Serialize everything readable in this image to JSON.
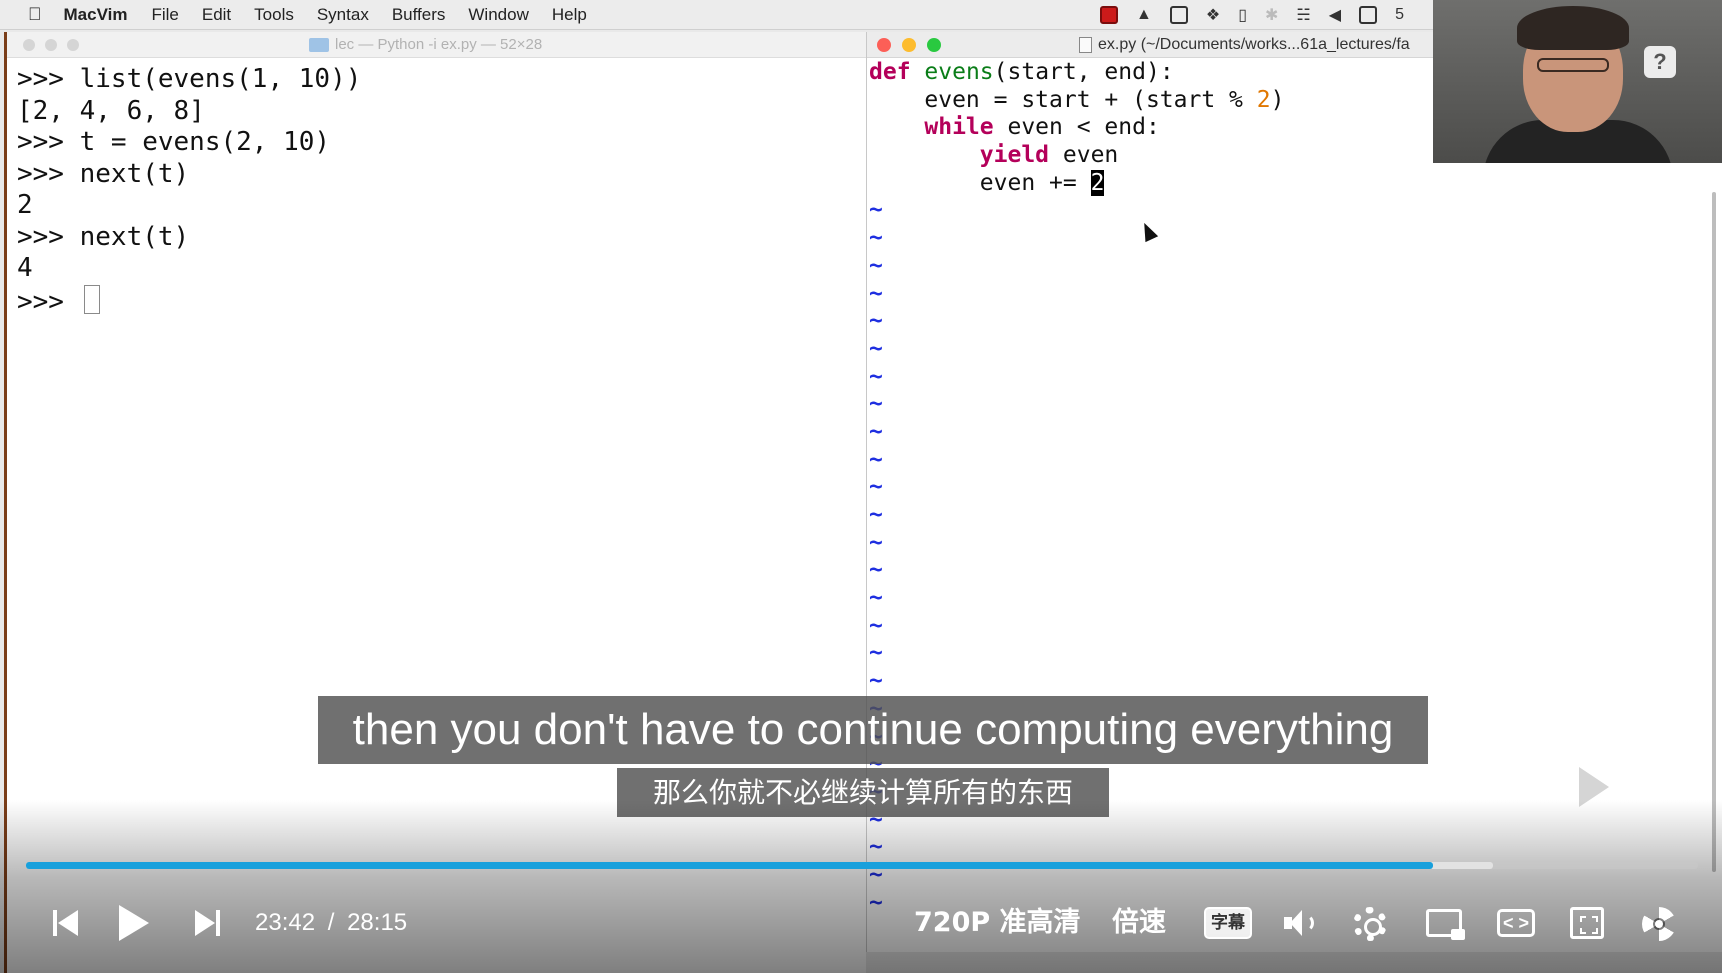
{
  "menubar": {
    "app_name": "MacVim",
    "items": [
      "File",
      "Edit",
      "Tools",
      "Syntax",
      "Buffers",
      "Window",
      "Help"
    ],
    "tray_trailing": "5"
  },
  "terminal": {
    "title": "lec — Python -i ex.py — 52×28",
    "lines": [
      ">>> list(evens(1, 10))",
      "[2, 4, 6, 8]",
      ">>> t = evens(2, 10)",
      ">>> next(t)",
      "2",
      ">>> next(t)",
      "4"
    ],
    "prompt": ">>> "
  },
  "vim": {
    "title": "ex.py (~/Documents/works...61a_lectures/fa",
    "code": {
      "l1_kw": "def",
      "l1_fn": "evens",
      "l1_rest": "(start, end):",
      "l2_a": "    even = start + (start % ",
      "l2_num": "2",
      "l2_b": ")",
      "l3_indent": "    ",
      "l3_kw": "while",
      "l3_rest": " even < end:",
      "l4_indent": "        ",
      "l4_kw": "yield",
      "l4_rest": " even",
      "l5_a": "        even += ",
      "l5_cursor": "2"
    },
    "tilde": "~"
  },
  "subtitles": {
    "english": "then you don't have to continue computing everything",
    "chinese": "那么你就不必继续计算所有的东西"
  },
  "player": {
    "current_time": "23:42",
    "separator": "/",
    "total_time": "28:15",
    "quality": "720P 准高清",
    "speed": "倍速",
    "subtitle_button": "字幕",
    "widescreen_glyph": "< >",
    "progress_fraction": 0.8416,
    "buffered_fraction": 0.8774,
    "progress_color": "#18a0dc"
  },
  "webcam": {
    "help_badge": "?"
  }
}
